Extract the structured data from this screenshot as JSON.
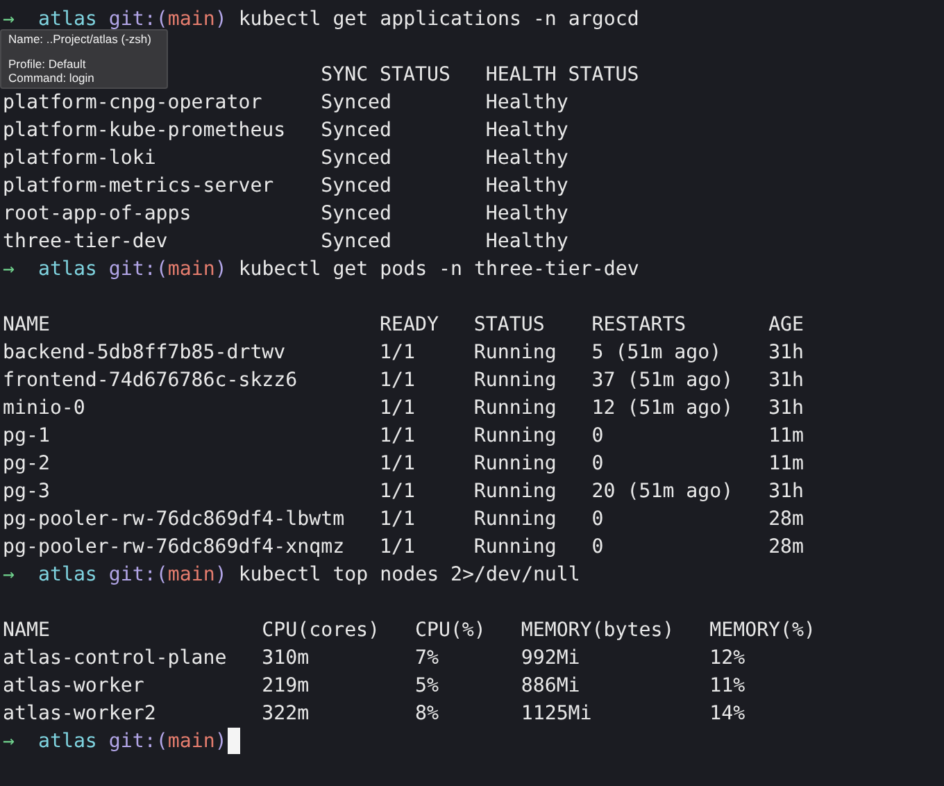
{
  "tooltip": {
    "lines": [
      "Name: ..Project/atlas (-zsh)",
      "Profile: Default",
      "Command: login"
    ]
  },
  "blocks": [
    {
      "prompt": {
        "arrow": "→",
        "dir": "atlas",
        "git": "git:(",
        "branch": "main",
        "git_close": ")"
      },
      "command": "kubectl get applications -n argocd",
      "table": {
        "columns": [
          null,
          "SYNC STATUS",
          "HEALTH STATUS"
        ],
        "rows": [
          [
            "platform-cnpg-operator",
            "Synced",
            "Healthy"
          ],
          [
            "platform-kube-prometheus",
            "Synced",
            "Healthy"
          ],
          [
            "platform-loki",
            "Synced",
            "Healthy"
          ],
          [
            "platform-metrics-server",
            "Synced",
            "Healthy"
          ],
          [
            "root-app-of-apps",
            "Synced",
            "Healthy"
          ],
          [
            "three-tier-dev",
            "Synced",
            "Healthy"
          ]
        ]
      }
    },
    {
      "prompt": {
        "arrow": "→",
        "dir": "atlas",
        "git": "git:(",
        "branch": "main",
        "git_close": ")"
      },
      "command": "kubectl get pods -n three-tier-dev",
      "table": {
        "columns": [
          "NAME",
          "READY",
          "STATUS",
          "RESTARTS",
          "AGE"
        ],
        "rows": [
          [
            "backend-5db8ff7b85-drtwv",
            "1/1",
            "Running",
            "5 (51m ago)",
            "31h"
          ],
          [
            "frontend-74d676786c-skzz6",
            "1/1",
            "Running",
            "37 (51m ago)",
            "31h"
          ],
          [
            "minio-0",
            "1/1",
            "Running",
            "12 (51m ago)",
            "31h"
          ],
          [
            "pg-1",
            "1/1",
            "Running",
            "0",
            "11m"
          ],
          [
            "pg-2",
            "1/1",
            "Running",
            "0",
            "11m"
          ],
          [
            "pg-3",
            "1/1",
            "Running",
            "20 (51m ago)",
            "31h"
          ],
          [
            "pg-pooler-rw-76dc869df4-lbwtm",
            "1/1",
            "Running",
            "0",
            "28m"
          ],
          [
            "pg-pooler-rw-76dc869df4-xnqmz",
            "1/1",
            "Running",
            "0",
            "28m"
          ]
        ]
      }
    },
    {
      "prompt": {
        "arrow": "→",
        "dir": "atlas",
        "git": "git:(",
        "branch": "main",
        "git_close": ")"
      },
      "command": "kubectl top nodes 2>/dev/null",
      "table": {
        "columns": [
          "NAME",
          "CPU(cores)",
          "CPU(%)",
          "MEMORY(bytes)",
          "MEMORY(%)"
        ],
        "rows": [
          [
            "atlas-control-plane",
            "310m",
            "7%",
            "992Mi",
            "12%"
          ],
          [
            "atlas-worker",
            "219m",
            "5%",
            "886Mi",
            "11%"
          ],
          [
            "atlas-worker2",
            "322m",
            "8%",
            "1125Mi",
            "14%"
          ]
        ]
      }
    },
    {
      "prompt": {
        "arrow": "→",
        "dir": "atlas",
        "git": "git:(",
        "branch": "main",
        "git_close": ")"
      },
      "cursor": true
    }
  ]
}
